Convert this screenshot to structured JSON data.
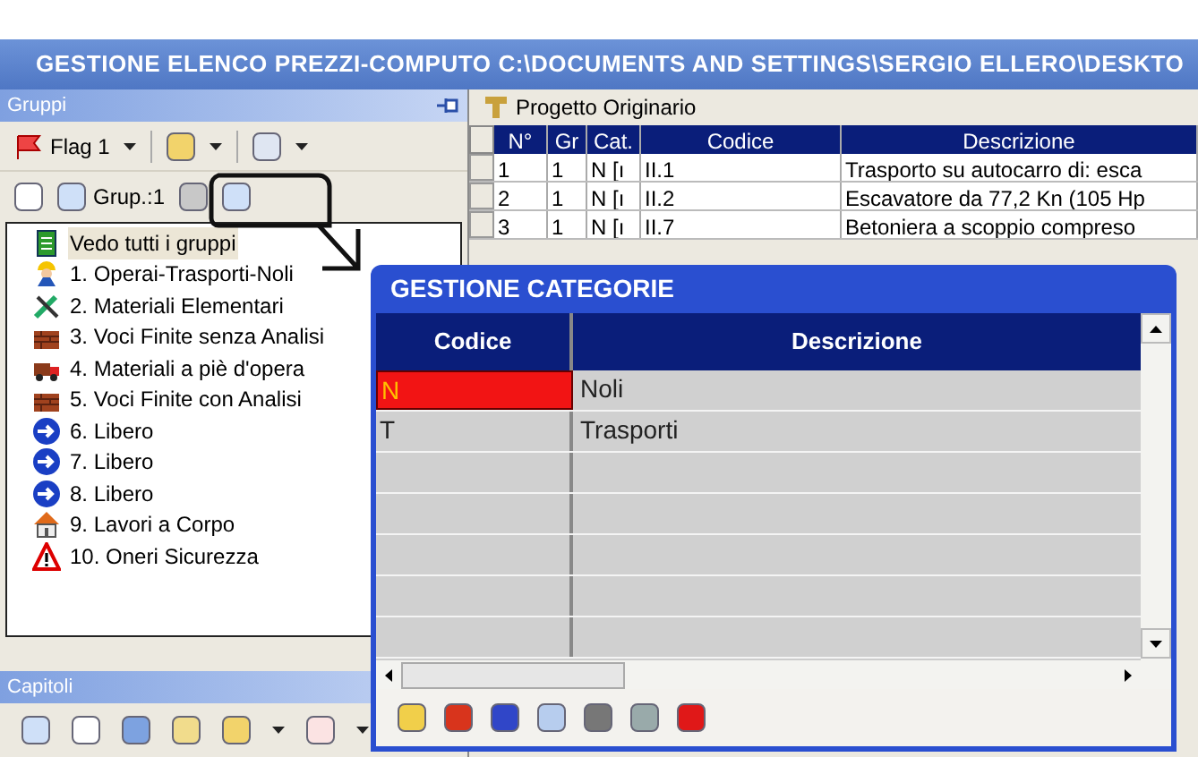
{
  "window": {
    "title": "GESTIONE ELENCO PREZZI-COMPUTO C:\\DOCUMENTS AND SETTINGS\\SERGIO ELLERO\\DESKTO"
  },
  "groups_panel": {
    "title": "Gruppi",
    "flag_button": "Flag 1",
    "group_label": "Grup.:1",
    "tree": [
      {
        "label": "Vedo tutti i gruppi",
        "kind": "all",
        "selected": true
      },
      {
        "label": "1. Operai-Trasporti-Noli",
        "kind": "worker",
        "selected": false
      },
      {
        "label": "2. Materiali Elementari",
        "kind": "tools",
        "selected": false
      },
      {
        "label": "3. Voci Finite senza Analisi",
        "kind": "bricks",
        "selected": false
      },
      {
        "label": "4. Materiali a piè d'opera",
        "kind": "truck",
        "selected": false
      },
      {
        "label": "5. Voci Finite con Analisi",
        "kind": "bricks",
        "selected": false
      },
      {
        "label": "6. Libero",
        "kind": "arrow",
        "selected": false
      },
      {
        "label": "7. Libero",
        "kind": "arrow",
        "selected": false
      },
      {
        "label": "8. Libero",
        "kind": "arrow",
        "selected": false
      },
      {
        "label": "9. Lavori a Corpo",
        "kind": "house",
        "selected": false
      },
      {
        "label": "10. Oneri Sicurezza",
        "kind": "warning",
        "selected": false
      }
    ]
  },
  "chapters_panel": {
    "title": "Capitoli"
  },
  "project": {
    "title": "Progetto Originario"
  },
  "table": {
    "columns": [
      "N°",
      "Gr",
      "Cat.",
      "Codice",
      "Descrizione"
    ],
    "rows": [
      {
        "n": "1",
        "gr": "1",
        "cat": "N  [ı",
        "code": "II.1",
        "desc": "Trasporto su autocarro di: esca"
      },
      {
        "n": "2",
        "gr": "1",
        "cat": "N  [ı",
        "code": "II.2",
        "desc": "Escavatore da 77,2 Kn (105 Hp"
      },
      {
        "n": "3",
        "gr": "1",
        "cat": "N  [ı",
        "code": "II.7",
        "desc": "Betoniera a scoppio compreso"
      }
    ]
  },
  "dialog": {
    "title": "GESTIONE CATEGORIE",
    "columns": [
      "Codice",
      "Descrizione"
    ],
    "rows": [
      {
        "code": "N",
        "desc": "Noli",
        "selected": true
      },
      {
        "code": "T",
        "desc": "Trasporti",
        "selected": false
      }
    ]
  }
}
